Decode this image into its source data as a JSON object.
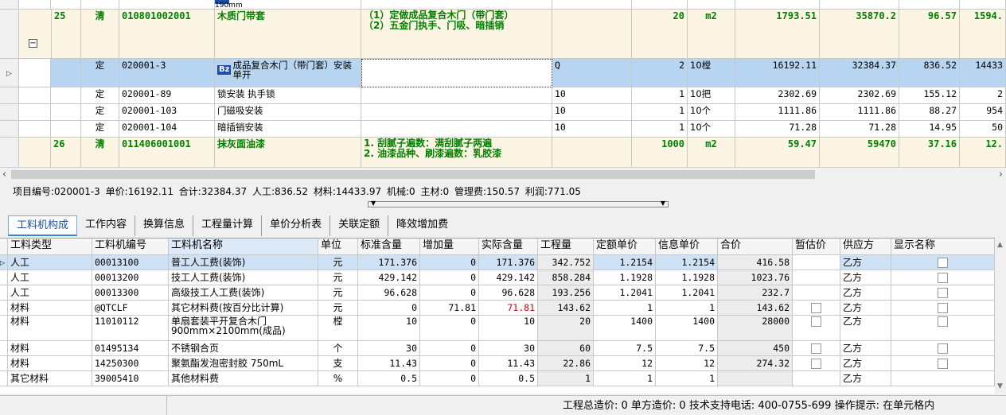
{
  "upper": {
    "top_partial": "190mm",
    "row25": {
      "no": "25",
      "type": "清",
      "code": "010801002001",
      "name": "木质门带套",
      "feature": "（1）定做成品复合木门（带门套）\n（2）五金门执手、门吸、暗插销",
      "qty": "20",
      "unit": "m2",
      "price": "1793.51",
      "total": "35870.2",
      "labor": "96.57",
      "mat": "1594."
    },
    "sub": [
      {
        "type": "定",
        "code": "020001-3",
        "name": "成品复合木门（带门套）安装 单开",
        "expr": "Q",
        "qty": "2",
        "unit": "10樘",
        "price": "16192.11",
        "total": "32384.37",
        "labor": "836.52",
        "mat": "14433"
      },
      {
        "type": "定",
        "code": "020001-89",
        "name": "锁安装 执手锁",
        "expr": "10",
        "qty": "1",
        "unit": "10把",
        "price": "2302.69",
        "total": "2302.69",
        "labor": "155.12",
        "mat": "2"
      },
      {
        "type": "定",
        "code": "020001-103",
        "name": "门磁吸安装",
        "expr": "10",
        "qty": "1",
        "unit": "10个",
        "price": "1111.86",
        "total": "1111.86",
        "labor": "88.27",
        "mat": "954"
      },
      {
        "type": "定",
        "code": "020001-104",
        "name": "暗插销安装",
        "expr": "10",
        "qty": "1",
        "unit": "10个",
        "price": "71.28",
        "total": "71.28",
        "labor": "14.95",
        "mat": "50"
      }
    ],
    "row26": {
      "no": "26",
      "type": "清",
      "code": "011406001001",
      "name": "抹灰面油漆",
      "feature": "1. 刮腻子遍数：满刮腻子两遍\n2. 油漆品种、刷漆遍数：乳胶漆",
      "qty": "1000",
      "unit": "m2",
      "price": "59.47",
      "total": "59470",
      "labor": "37.16",
      "mat": "12."
    },
    "bz_icon": "Bz"
  },
  "infoline": {
    "code": "项目编号:020001-3",
    "price": "单价:16192.11",
    "total": "合计:32384.37",
    "labor": "人工:836.52",
    "material": "材料:14433.97",
    "machine": "机械:0",
    "main": "主材:0",
    "mgmt": "管理费:150.57",
    "profit": "利润:771.05"
  },
  "tabs": [
    "工料机构成",
    "工作内容",
    "换算信息",
    "工程量计算",
    "单价分析表",
    "关联定额",
    "降效增加费"
  ],
  "lower": {
    "headers": [
      "工料类型",
      "工料机编号",
      "工料机名称",
      "单位",
      "标准含量",
      "增加量",
      "实际含量",
      "工程量",
      "定额单价",
      "信息单价",
      "合价",
      "暂估价",
      "供应方",
      "显示名称"
    ],
    "rows": [
      {
        "cat": "人工",
        "code": "00013100",
        "name": "普工人工费(装饰)",
        "unit": "元",
        "std": "171.376",
        "add": "0",
        "actual": "171.376",
        "qty": "342.752",
        "qprice": "1.2154",
        "iprice": "1.2154",
        "sum": "416.58",
        "supplier": "乙方"
      },
      {
        "cat": "人工",
        "code": "00013200",
        "name": "技工人工费(装饰)",
        "unit": "元",
        "std": "429.142",
        "add": "0",
        "actual": "429.142",
        "qty": "858.284",
        "qprice": "1.1928",
        "iprice": "1.1928",
        "sum": "1023.76",
        "supplier": "乙方"
      },
      {
        "cat": "人工",
        "code": "00013300",
        "name": "高级技工人工费(装饰)",
        "unit": "元",
        "std": "96.628",
        "add": "0",
        "actual": "96.628",
        "qty": "193.256",
        "qprice": "1.2041",
        "iprice": "1.2041",
        "sum": "232.7",
        "supplier": "乙方"
      },
      {
        "cat": "材料",
        "code": "@QTCLF",
        "name": "其它材料费(按百分比计算)",
        "unit": "元",
        "std": "0",
        "add": "71.81",
        "actual": "71.81",
        "qty": "143.62",
        "qprice": "1",
        "iprice": "1",
        "sum": "143.62",
        "supplier": "乙方"
      },
      {
        "cat": "材料",
        "code": "11010112",
        "name": "单扇套装平开复合木门 900mm×2100mm(成品)",
        "unit": "樘",
        "std": "10",
        "add": "0",
        "actual": "10",
        "qty": "20",
        "qprice": "1400",
        "iprice": "1400",
        "sum": "28000",
        "supplier": "乙方"
      },
      {
        "cat": "材料",
        "code": "01495134",
        "name": "不锈钢合页",
        "unit": "个",
        "std": "30",
        "add": "0",
        "actual": "30",
        "qty": "60",
        "qprice": "7.5",
        "iprice": "7.5",
        "sum": "450",
        "supplier": "乙方"
      },
      {
        "cat": "材料",
        "code": "14250300",
        "name": "聚氨酯发泡密封胶 750mL",
        "unit": "支",
        "std": "11.43",
        "add": "0",
        "actual": "11.43",
        "qty": "22.86",
        "qprice": "12",
        "iprice": "12",
        "sum": "274.32",
        "supplier": "乙方"
      },
      {
        "cat": "其它材料",
        "code": "39005410",
        "name": "其他材料费",
        "unit": "%",
        "std": "0.5",
        "add": "0",
        "actual": "0.5",
        "qty": "1",
        "qprice": "1",
        "iprice": "1",
        "sum": "",
        "supplier": "乙方"
      }
    ]
  },
  "status": {
    "text": "工程总造价: 0  单方造价: 0  技术支持电话: 400-0755-699  操作提示: 在单元格内"
  }
}
